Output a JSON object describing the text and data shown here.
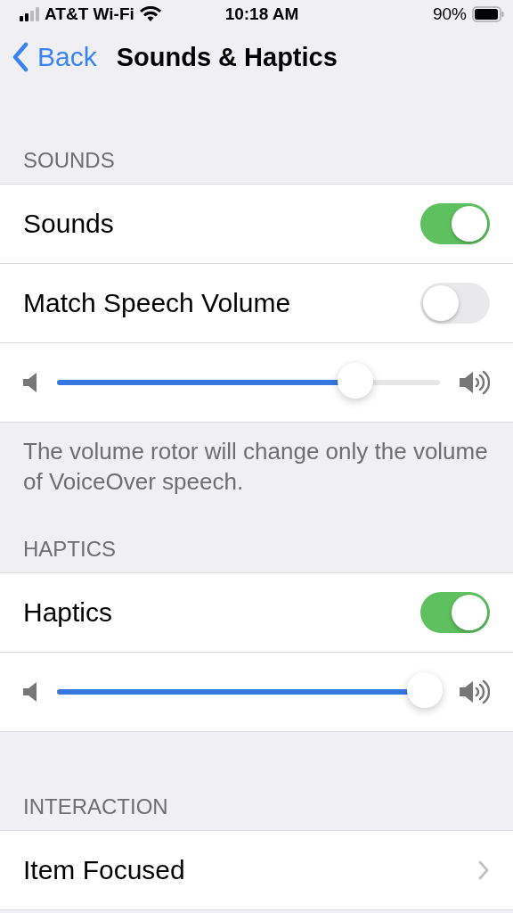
{
  "status_bar": {
    "carrier": "AT&T Wi-Fi",
    "time": "10:18 AM",
    "battery": "90%"
  },
  "nav": {
    "back": "Back",
    "title": "Sounds & Haptics"
  },
  "sections": [
    {
      "header": "SOUNDS",
      "rows": [
        {
          "kind": "toggle",
          "label": "Sounds",
          "on": true
        },
        {
          "kind": "toggle",
          "label": "Match Speech Volume",
          "on": false
        },
        {
          "kind": "slider",
          "level": 0.78
        }
      ],
      "footer": "The volume rotor will change only the volume of VoiceOver speech."
    },
    {
      "header": "HAPTICS",
      "rows": [
        {
          "kind": "toggle",
          "label": "Haptics",
          "on": true
        },
        {
          "kind": "slider",
          "level": 0.96
        }
      ]
    },
    {
      "header": "INTERACTION",
      "rows": [
        {
          "kind": "link",
          "label": "Item Focused"
        }
      ]
    }
  ]
}
